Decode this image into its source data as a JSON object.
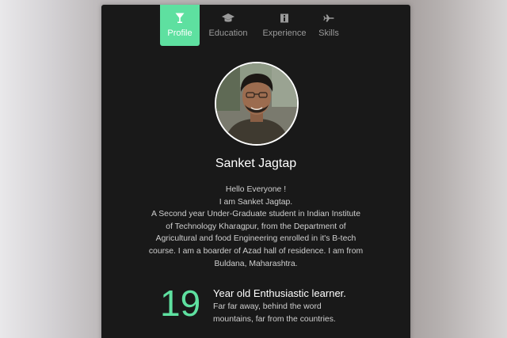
{
  "nav": {
    "tabs": [
      {
        "label": "Profile",
        "icon": "glass-icon",
        "active": true
      },
      {
        "label": "Education",
        "icon": "graduation-cap-icon",
        "active": false
      },
      {
        "label": "Experience",
        "icon": "info-icon",
        "active": false
      },
      {
        "label": "Skills",
        "icon": "plane-icon",
        "active": false
      }
    ]
  },
  "profile": {
    "name": "Sanket Jagtap",
    "bio_lines": [
      "Hello Everyone !",
      "I am Sanket Jagtap.",
      "A Second year Under-Graduate student in Indian Institute of Technology Kharagpur, from the Department of Agricultural and food Engineering enrolled in it's B-tech course. I am a boarder of Azad hall of residence. I am from Buldana, Maharashtra."
    ],
    "age": "19",
    "age_title": "Year old Enthusiastic learner.",
    "age_desc": "Far far away, behind the word mountains, far from the countries."
  },
  "colors": {
    "accent": "#5ee0a0",
    "panel": "#191919"
  }
}
